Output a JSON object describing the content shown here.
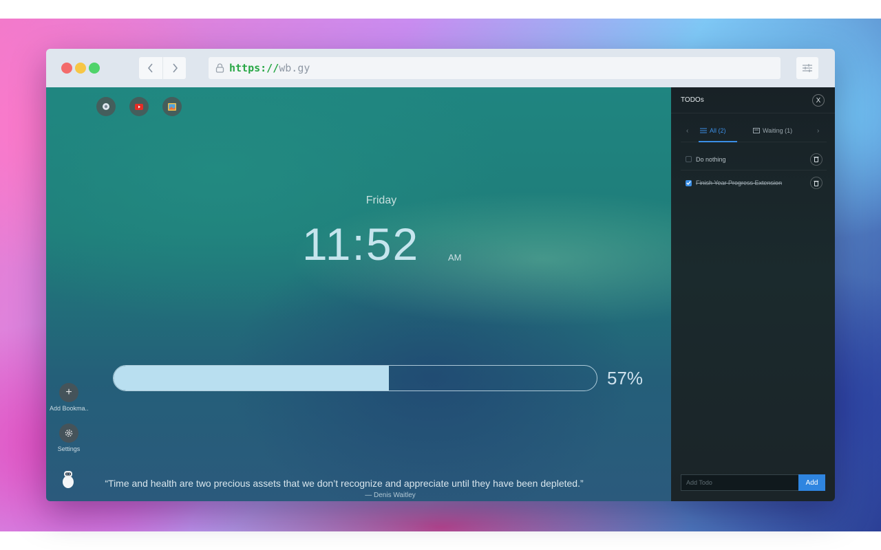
{
  "browser": {
    "url_scheme": "https://",
    "url_host": "wb.gy",
    "icons": {
      "lock": "lock-icon",
      "back": "chevron-left-icon",
      "forward": "chevron-right-icon",
      "settings": "sliders-icon"
    }
  },
  "shortcuts": [
    {
      "name": "shortcut-1",
      "icon": "globe-icon"
    },
    {
      "name": "shortcut-2",
      "icon": "youtube-icon"
    },
    {
      "name": "shortcut-3",
      "icon": "image-icon"
    }
  ],
  "clock": {
    "day": "Friday",
    "time": "11:52",
    "ampm": "AM"
  },
  "year_progress": {
    "percent_label": "57%",
    "fraction": 0.57
  },
  "sidebar": {
    "add_bookmark_label": "Add Bookma..",
    "settings_label": "Settings"
  },
  "quote": {
    "text": "“Time and health are two precious assets that we don’t recognize and appreciate until they have been depleted.”",
    "author": "— Denis Waitley"
  },
  "todos": {
    "title": "TODOs",
    "close_label": "X",
    "tabs": [
      {
        "label": "All (2)",
        "active": true
      },
      {
        "label": "Waiting (1)",
        "active": false
      }
    ],
    "items": [
      {
        "text": "Do nothing",
        "done": false
      },
      {
        "text": "Finish Year Progress Extension",
        "done": true
      }
    ],
    "input_placeholder": "Add Todo",
    "add_label": "Add"
  },
  "colors": {
    "accent": "#3b8fe6",
    "progress_fill": "#b9dff0",
    "url_scheme": "#28a745",
    "traffic_red": "#f36b6b",
    "traffic_yellow": "#f7c645",
    "traffic_green": "#4fd36a"
  }
}
